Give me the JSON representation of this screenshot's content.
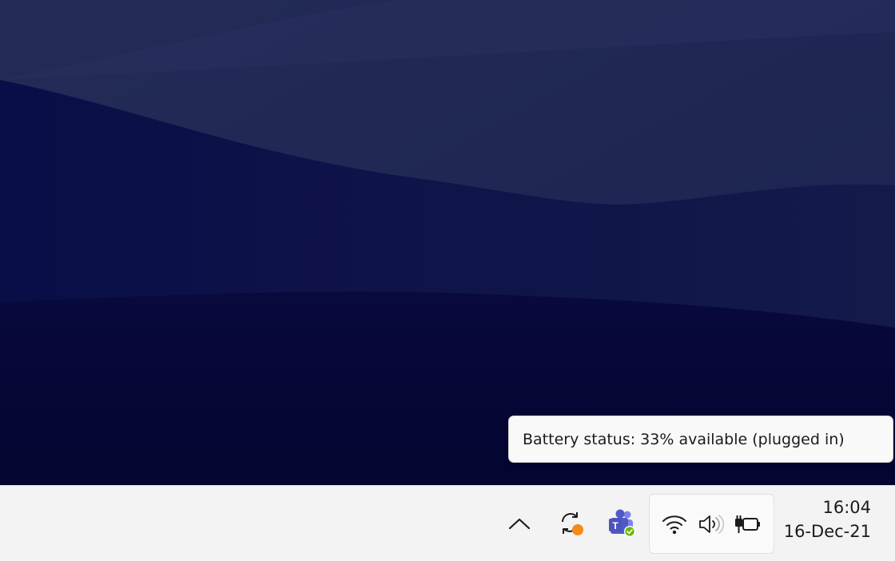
{
  "desktop": {
    "wallpaper_colors": [
      "#1d2452",
      "#101640",
      "#06083a"
    ]
  },
  "tooltip": {
    "text": "Battery status: 33% available (plugged in)"
  },
  "taskbar": {
    "background": "#f3f3f3",
    "tray_icons": [
      {
        "name": "chevron-up-icon"
      },
      {
        "name": "sync-icon",
        "badge_color": "#f28c13"
      },
      {
        "name": "teams-icon",
        "brand_color": "#5059c9",
        "status_color": "#6bb700"
      }
    ],
    "quick_settings": [
      {
        "name": "wifi-icon"
      },
      {
        "name": "speaker-icon"
      },
      {
        "name": "battery-plugged-icon"
      }
    ],
    "clock": {
      "time": "16:04",
      "date": "16-Dec-21"
    }
  }
}
